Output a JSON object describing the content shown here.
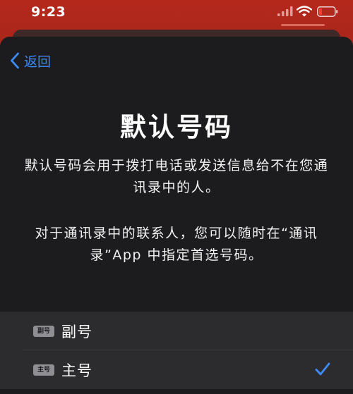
{
  "status_bar": {
    "time": "9:23"
  },
  "nav": {
    "back_label": "返回"
  },
  "page": {
    "title": "默认号码",
    "description_1": "默认号码会用于拨打电话或发送信息给不在您通讯录中的人。",
    "description_2": "对于通讯录中的联系人，您可以随时在“通讯录”App 中指定首选号码。"
  },
  "options": [
    {
      "badge": "副号",
      "label": "副号",
      "selected": false
    },
    {
      "badge": "主号",
      "label": "主号",
      "selected": true
    }
  ],
  "colors": {
    "accent": "#3d8bf5",
    "sheet_bg": "#1c1c1e",
    "row_bg": "#2c2c2e",
    "battery_low": "#ff3b30"
  },
  "icons": {
    "back": "chevron-left-icon",
    "selected": "checkmark-icon",
    "signal": "signal-icon",
    "wifi": "wifi-icon",
    "battery": "battery-icon"
  }
}
